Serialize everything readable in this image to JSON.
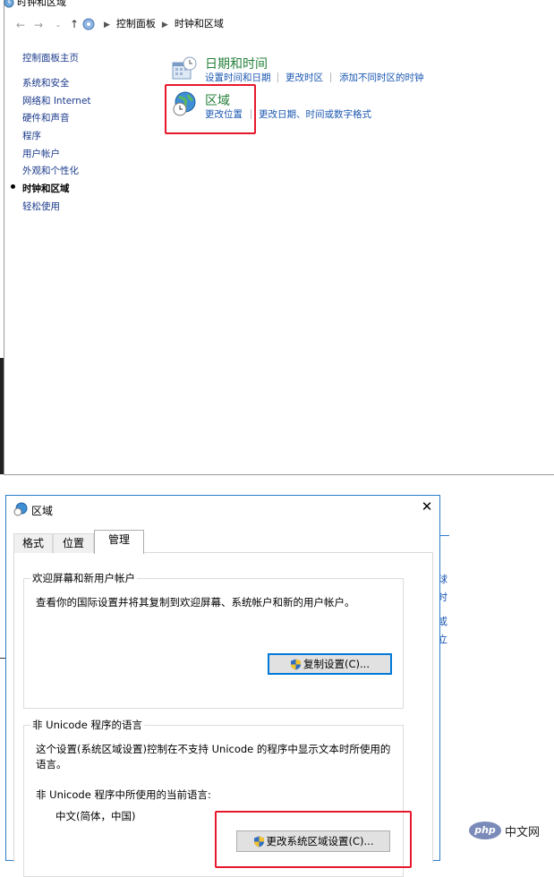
{
  "control_panel": {
    "window_title": "时钟和区域",
    "breadcrumb": [
      "控制面板",
      "时钟和区域"
    ],
    "sidebar": {
      "items": [
        {
          "label": "控制面板主页"
        },
        {
          "label": "系统和安全"
        },
        {
          "label": "网络和 Internet"
        },
        {
          "label": "硬件和声音"
        },
        {
          "label": "程序"
        },
        {
          "label": "用户帐户"
        },
        {
          "label": "外观和个性化"
        },
        {
          "label": "时钟和区域",
          "active": true
        },
        {
          "label": "轻松使用"
        }
      ]
    },
    "categories": [
      {
        "title": "日期和时间",
        "links": [
          "设置时间和日期",
          "更改时区",
          "添加不同时区的时钟"
        ]
      },
      {
        "title": "区域",
        "links": [
          "更改位置",
          "更改日期、时间或数字格式"
        ]
      }
    ]
  },
  "dialog": {
    "title": "区域",
    "close_icon": "close-icon",
    "tabs": [
      "格式",
      "位置",
      "管理"
    ],
    "selected_tab": "管理",
    "welcome_group": {
      "title": "欢迎屏幕和新用户帐户",
      "description": "查看你的国际设置并将其复制到欢迎屏幕、系统帐户和新的用户帐户。",
      "button": "复制设置(C)..."
    },
    "unicode_group": {
      "title": "非 Unicode 程序的语言",
      "description": "这个设置(系统区域设置)控制在不支持 Unicode 的程序中显示文本时所使用的语言。",
      "current_label": "非 Unicode 程序中所使用的当前语言:",
      "current_value": "中文(简体，中国)",
      "button": "更改系统区域设置(C)..."
    }
  },
  "background_fragments": [
    "球",
    "时",
    "或",
    "立"
  ],
  "watermark": {
    "logo": "php",
    "text": "中文网"
  },
  "colors": {
    "link": "#1a56b0",
    "category_title": "#26813b",
    "highlight_box": "#e8182c",
    "focus_border": "#0078d7"
  }
}
